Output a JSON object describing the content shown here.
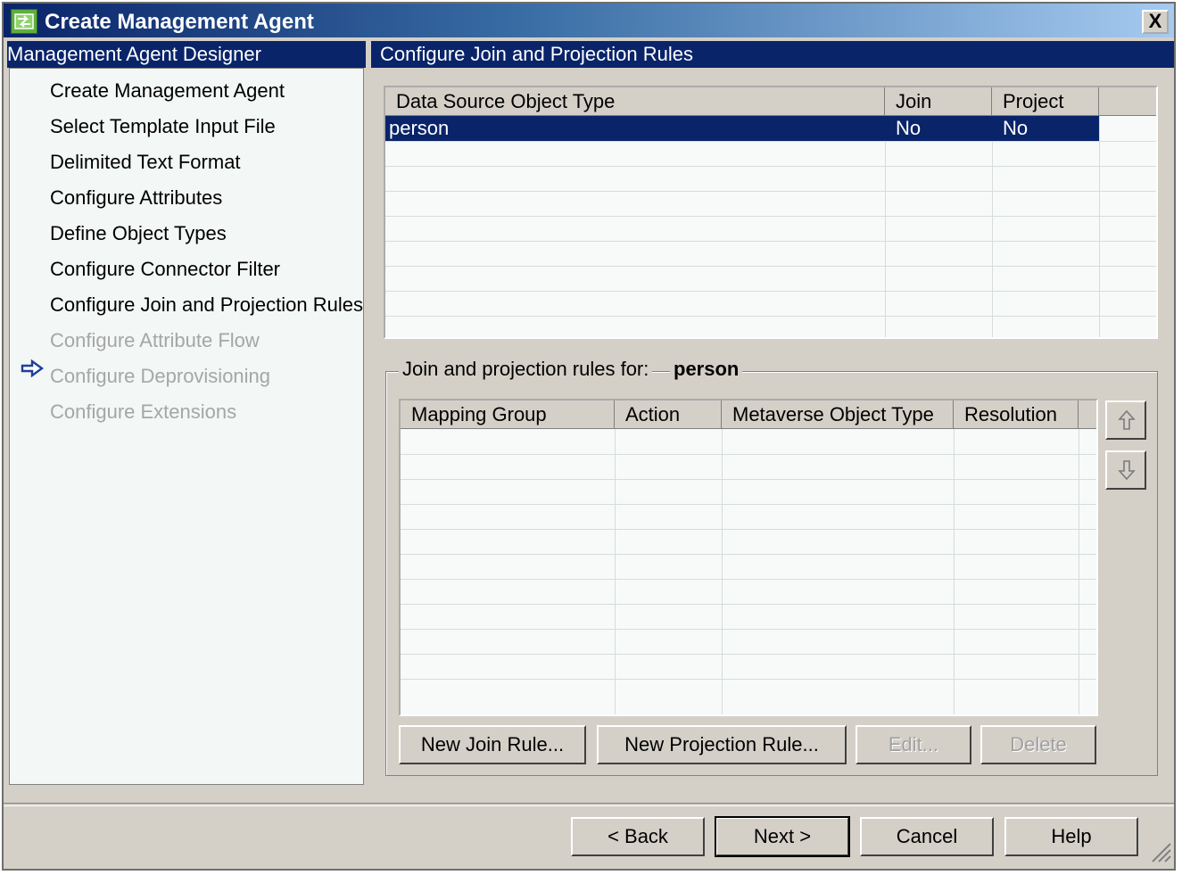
{
  "window": {
    "title": "Create Management Agent",
    "close_label": "X"
  },
  "left_panel": {
    "header": "Management Agent Designer",
    "steps": [
      {
        "label": "Create Management Agent",
        "state": "done"
      },
      {
        "label": "Select Template Input File",
        "state": "done"
      },
      {
        "label": "Delimited Text Format",
        "state": "done"
      },
      {
        "label": "Configure Attributes",
        "state": "done"
      },
      {
        "label": "Define Object Types",
        "state": "done"
      },
      {
        "label": "Configure Connector Filter",
        "state": "done"
      },
      {
        "label": "Configure Join and Projection Rules",
        "state": "current"
      },
      {
        "label": "Configure Attribute Flow",
        "state": "disabled"
      },
      {
        "label": "Configure Deprovisioning",
        "state": "disabled"
      },
      {
        "label": "Configure Extensions",
        "state": "disabled"
      }
    ]
  },
  "right_panel": {
    "header": "Configure Join and Projection Rules",
    "object_types_table": {
      "columns": [
        "Data Source Object Type",
        "Join",
        "Project"
      ],
      "rows": [
        {
          "type": "person",
          "join": "No",
          "project": "No",
          "selected": true
        }
      ]
    },
    "rules_group": {
      "label": "Join and projection rules for:",
      "object_type": "person",
      "columns": [
        "Mapping Group",
        "Action",
        "Metaverse Object Type",
        "Resolution"
      ],
      "rows": []
    },
    "buttons": {
      "new_join_rule": "New Join Rule...",
      "new_projection_rule": "New Projection Rule...",
      "edit": "Edit...",
      "delete": "Delete"
    }
  },
  "footer": {
    "back": "<  Back",
    "next": "Next  >",
    "cancel": "Cancel",
    "help": "Help"
  },
  "colors": {
    "title_bar": "#0a246a",
    "selection": "#0a246a",
    "face": "#d4d0c8"
  },
  "icons": [
    "app-icon",
    "close-icon",
    "current-step-arrow-icon",
    "move-up-icon",
    "move-down-icon",
    "size-grip-icon"
  ]
}
